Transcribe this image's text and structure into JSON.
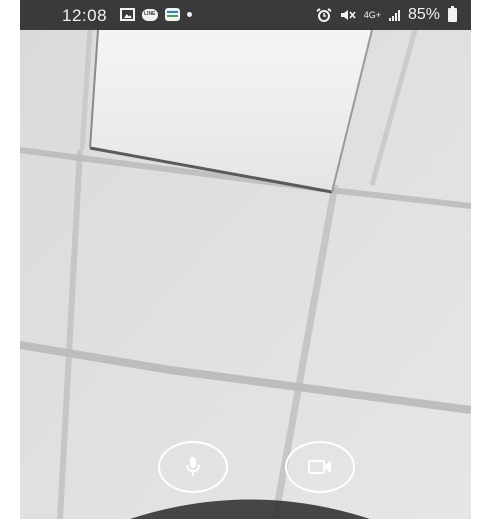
{
  "status_bar": {
    "time": "12:08",
    "network": "4G+",
    "battery": "85%",
    "icons": [
      "gallery-icon",
      "line-app-icon",
      "messages-icon",
      "notification-dot-icon",
      "alarm-icon",
      "mute-icon",
      "signal-icon",
      "battery-icon"
    ]
  },
  "call_controls": {
    "mic_icon": "mic-icon",
    "camera_icon": "video-camera-icon"
  },
  "colors": {
    "status_bar_bg": "#3a3a3a",
    "control_outline": "#ffffff"
  }
}
